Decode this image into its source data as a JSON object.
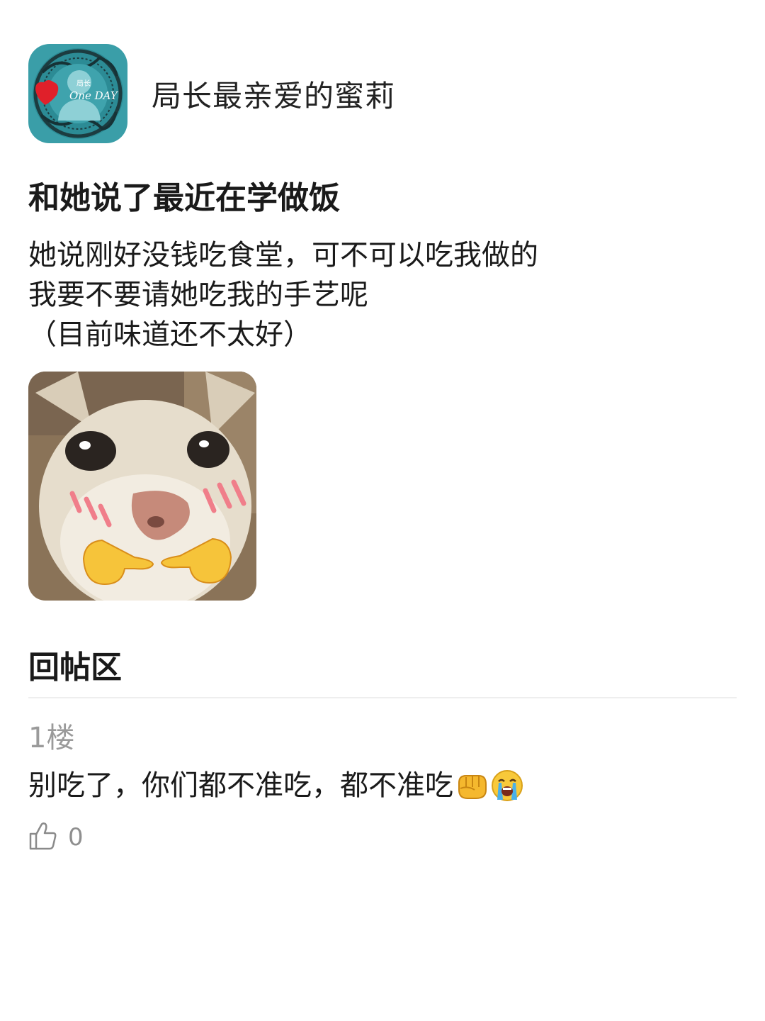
{
  "author": {
    "name": "局长最亲爱的蜜莉",
    "avatar_badge_top": "局长",
    "avatar_badge_main": "One DAY",
    "avatar_color": "#3a9ea8"
  },
  "post": {
    "title": "和她说了最近在学做饭",
    "body_lines": [
      "她说刚好没钱吃食堂，可不可以吃我做的",
      "我要不要请她吃我的手艺呢",
      "（目前味道还不太好）"
    ],
    "image_icon": "cat-pointing-fingers-meme"
  },
  "replies_section": {
    "title": "回帖区",
    "replies": [
      {
        "floor": "1楼",
        "text": "别吃了，你们都不准吃，都不准吃",
        "emojis": [
          "fist-icon",
          "loudly-crying-face-icon"
        ],
        "likes": "0"
      }
    ]
  }
}
